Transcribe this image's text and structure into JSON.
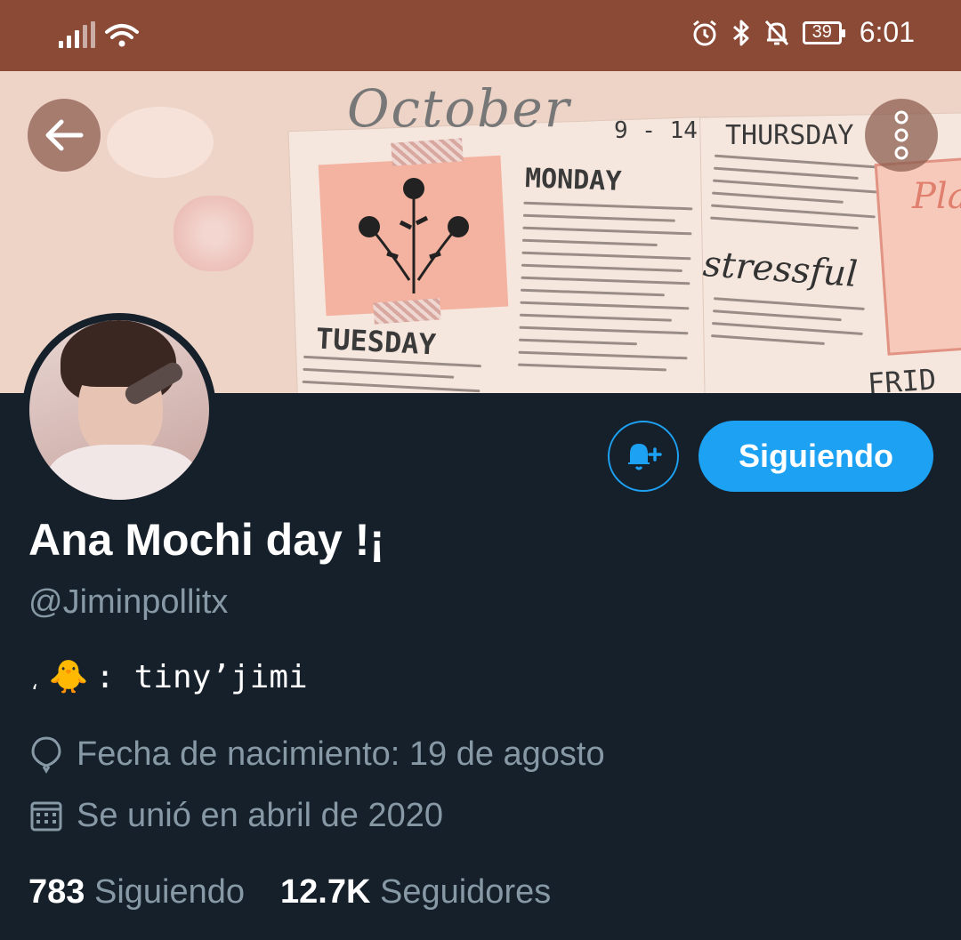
{
  "status_bar": {
    "time": "6:01",
    "battery": "39"
  },
  "profile": {
    "display_name": "Ana Mochi day !¡",
    "handle": "@Jiminpollitx",
    "bio_prefix": "،",
    "bio_emoji": "🐥",
    "bio_text": ": tiny’jimi",
    "birthday": "Fecha de nacimiento: 19 de agosto",
    "joined": "Se unió en abril de 2020",
    "following_count": "783",
    "following_label": "Siguiendo",
    "followers_count": "12.7K",
    "followers_label": "Seguidores",
    "follow_button_label": "Siguiendo"
  },
  "banner": {
    "month": "October",
    "dates": "9 - 14",
    "day1": "MONDAY",
    "day2": "TUESDAY",
    "day3": "THURSDAY",
    "day4": "FRID",
    "word": "stressful",
    "plan": "Pla"
  },
  "icons": {
    "back": "arrow-left-icon",
    "more": "more-vertical-icon",
    "notify": "bell-plus-icon",
    "birthday": "balloon-icon",
    "calendar": "calendar-icon"
  },
  "colors": {
    "accent": "#1da1f2",
    "background": "#15202b",
    "status_bar": "#8a4a36",
    "muted_text": "#8899a6"
  }
}
